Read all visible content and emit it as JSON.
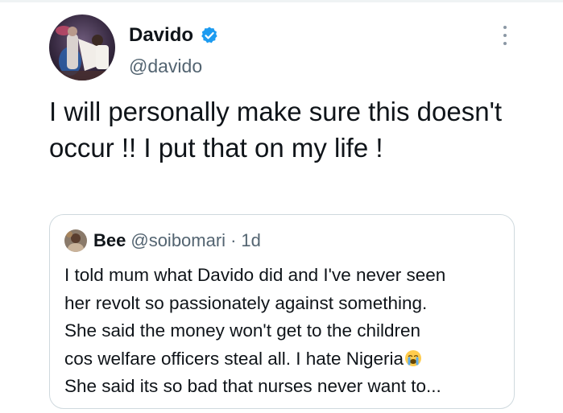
{
  "tweet": {
    "author": {
      "name": "Davido",
      "handle": "@davido",
      "verified": true,
      "avatar": "avatar-photo"
    },
    "menu_icon": "more-options-icon",
    "text": "I will personally make sure this doesn't occur !! I put that on my life !"
  },
  "quoted_tweet": {
    "author": {
      "name": "Bee",
      "handle": "@soibomari",
      "avatar": "avatar-photo"
    },
    "separator": "·",
    "time": "1d",
    "lines": [
      "I told mum what Davido did and I've never seen",
      "her revolt so passionately against something.",
      "She said the money won't get to the children",
      "cos welfare officers steal all. I hate Nigeria",
      "She said its so bad that nurses never want to..."
    ],
    "emoji": "loudly-crying-face"
  },
  "colors": {
    "text": "#0f1419",
    "secondary": "#536471",
    "verified": "#1d9bf0",
    "border": "#cfd9de"
  }
}
